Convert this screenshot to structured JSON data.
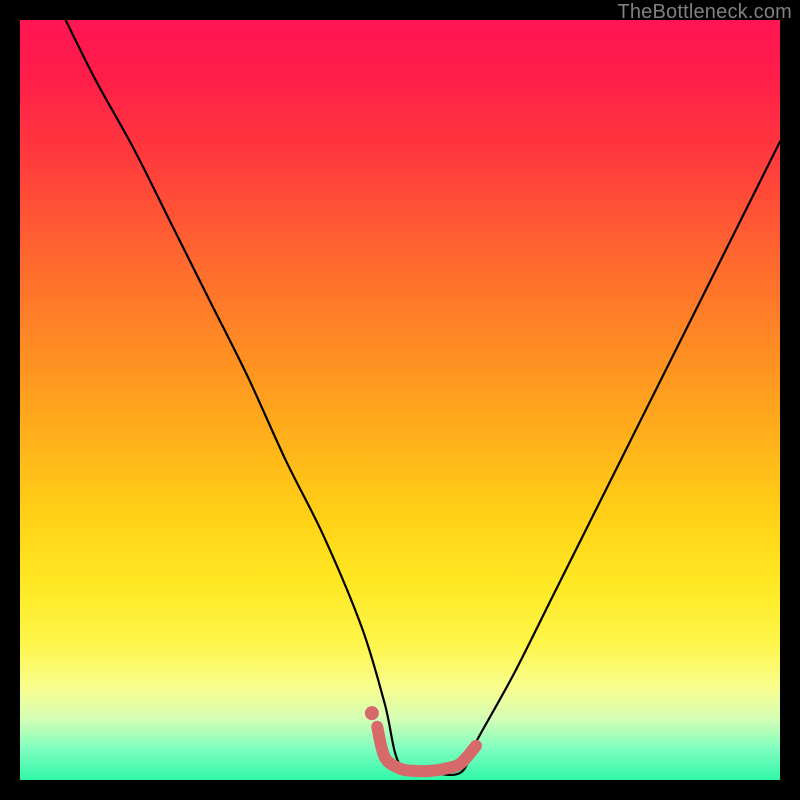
{
  "watermark": "TheBottleneck.com",
  "chart_data": {
    "type": "line",
    "title": "",
    "xlabel": "",
    "ylabel": "",
    "xlim": [
      0,
      100
    ],
    "ylim": [
      0,
      100
    ],
    "grid": false,
    "legend_position": "none",
    "series": [
      {
        "name": "bottleneck-curve",
        "x": [
          6,
          10,
          15,
          20,
          25,
          30,
          35,
          40,
          45,
          48,
          50,
          54,
          58,
          60,
          65,
          70,
          75,
          80,
          85,
          90,
          95,
          100
        ],
        "values": [
          100,
          92,
          83,
          73,
          63,
          53,
          42,
          32,
          20,
          10,
          2,
          1,
          1,
          5,
          14,
          24,
          34,
          44,
          54,
          64,
          74,
          84
        ]
      },
      {
        "name": "highlight-segment",
        "x": [
          47,
          48,
          50,
          52,
          54,
          56,
          58,
          60
        ],
        "values": [
          7,
          3,
          1.5,
          1.2,
          1.2,
          1.5,
          2.2,
          4.5
        ]
      },
      {
        "name": "highlight-dot",
        "x": [
          46.3
        ],
        "values": [
          8.8
        ]
      }
    ],
    "background_gradient": {
      "top": "#ff1553",
      "mid": "#ffe823",
      "bottom": "#2ff7a6"
    },
    "highlight_color": "#d66a6a"
  }
}
